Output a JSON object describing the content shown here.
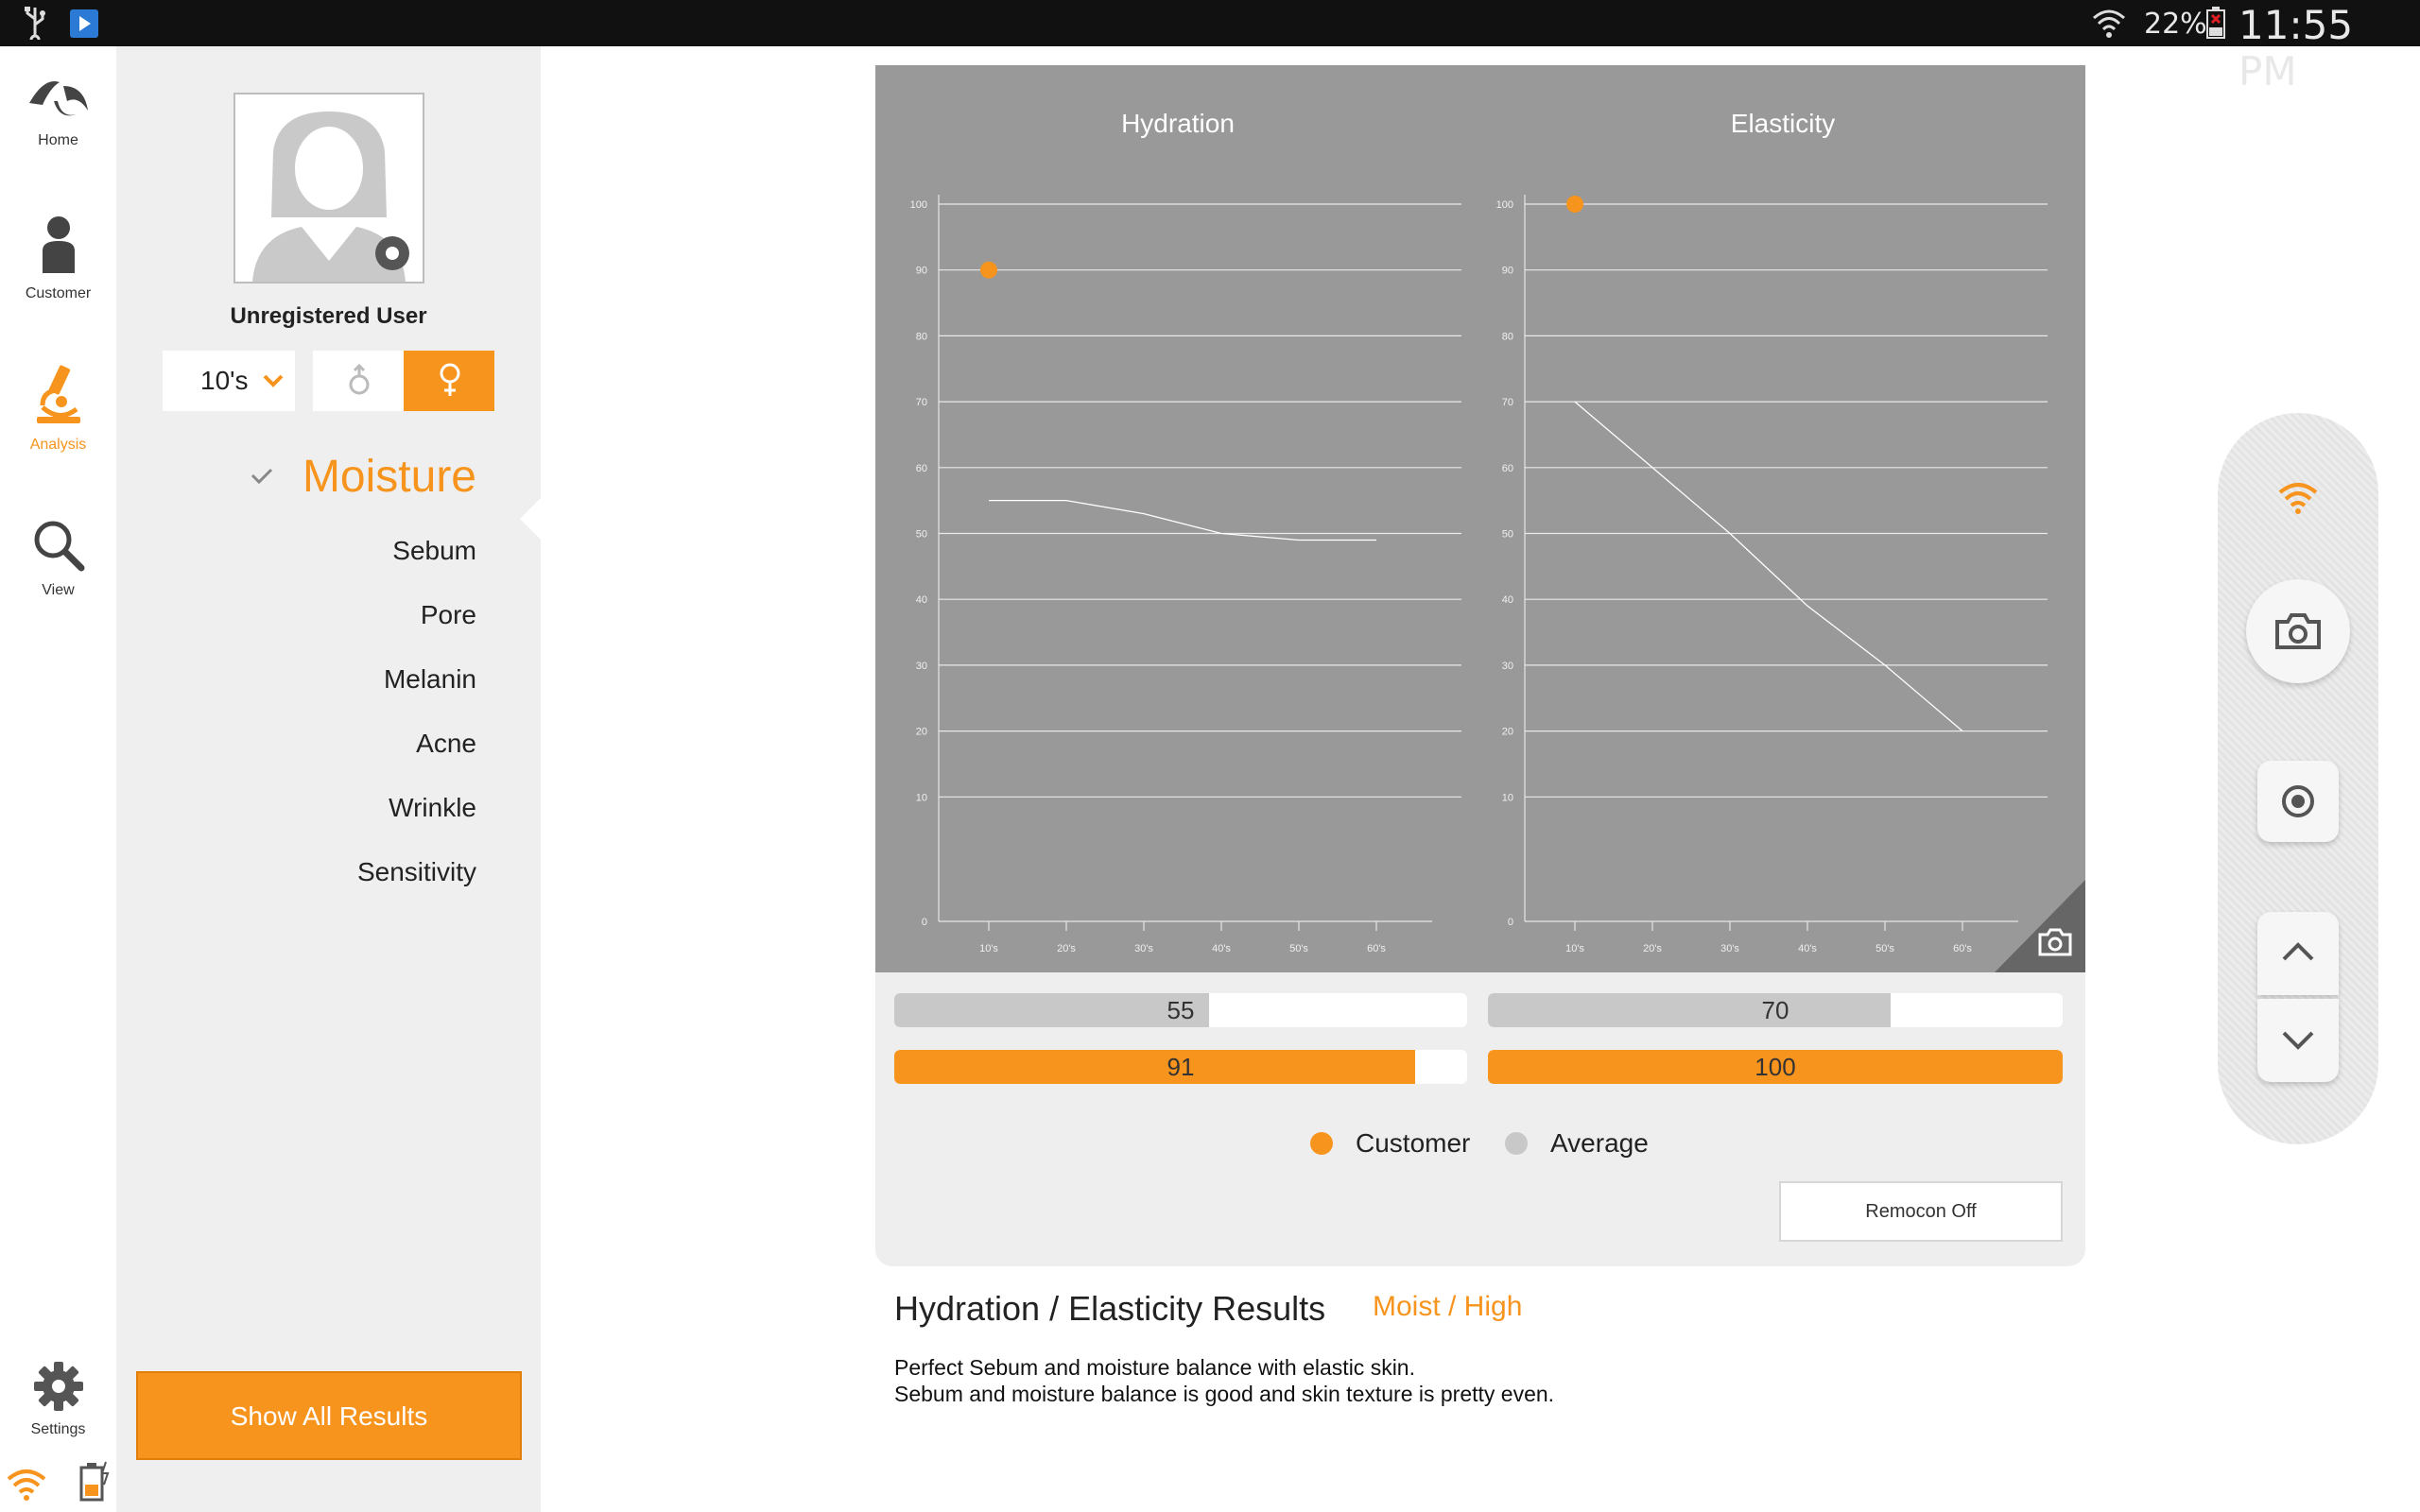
{
  "status_bar": {
    "battery": "22%",
    "time": "11:55 PM"
  },
  "nav": {
    "items": [
      {
        "label": "Home"
      },
      {
        "label": "Customer"
      },
      {
        "label": "Analysis"
      },
      {
        "label": "View"
      },
      {
        "label": "Settings"
      }
    ],
    "active": "Analysis"
  },
  "profile": {
    "name": "Unregistered User",
    "age_group": "10's",
    "selected_gender": "female"
  },
  "menu": {
    "items": [
      "Moisture",
      "Sebum",
      "Pore",
      "Melanin",
      "Acne",
      "Wrinkle",
      "Sensitivity"
    ],
    "active": "Moisture"
  },
  "show_all_label": "Show All Results",
  "colors": {
    "accent": "#f7941d",
    "chart_bg": "#999999",
    "average": "#c8c8c8"
  },
  "chart_data": [
    {
      "type": "line",
      "title": "Hydration",
      "categories": [
        "10's",
        "20's",
        "30's",
        "40's",
        "50's",
        "60's"
      ],
      "yticks": [
        "0",
        "10",
        "20",
        "30",
        "40",
        "50",
        "60",
        "70",
        "80",
        "90",
        "100"
      ],
      "ylim": [
        0,
        100
      ],
      "series": [
        {
          "values": [
            55,
            55,
            53,
            50,
            49,
            49
          ]
        }
      ],
      "customer_point": {
        "x": "10's",
        "y": 90
      }
    },
    {
      "type": "line",
      "title": "Elasticity",
      "categories": [
        "10's",
        "20's",
        "30's",
        "40's",
        "50's",
        "60's"
      ],
      "yticks": [
        "0",
        "10",
        "20",
        "30",
        "40",
        "50",
        "60",
        "70",
        "80",
        "90",
        "100"
      ],
      "ylim": [
        0,
        100
      ],
      "series": [
        {
          "values": [
            70,
            60,
            50,
            39,
            30,
            20
          ]
        }
      ],
      "customer_point": {
        "x": "10's",
        "y": 100
      }
    }
  ],
  "bars": {
    "hydration": {
      "average": 55,
      "customer": 91
    },
    "elasticity": {
      "average": 70,
      "customer": 100
    }
  },
  "legend": {
    "customer": "Customer",
    "average": "Average"
  },
  "remocon_label": "Remocon Off",
  "results": {
    "title": "Hydration / Elasticity Results",
    "status": "Moist / High",
    "description": [
      "Perfect Sebum and moisture balance with elastic skin.",
      "Sebum and moisture balance is good and skin texture is pretty even."
    ]
  }
}
